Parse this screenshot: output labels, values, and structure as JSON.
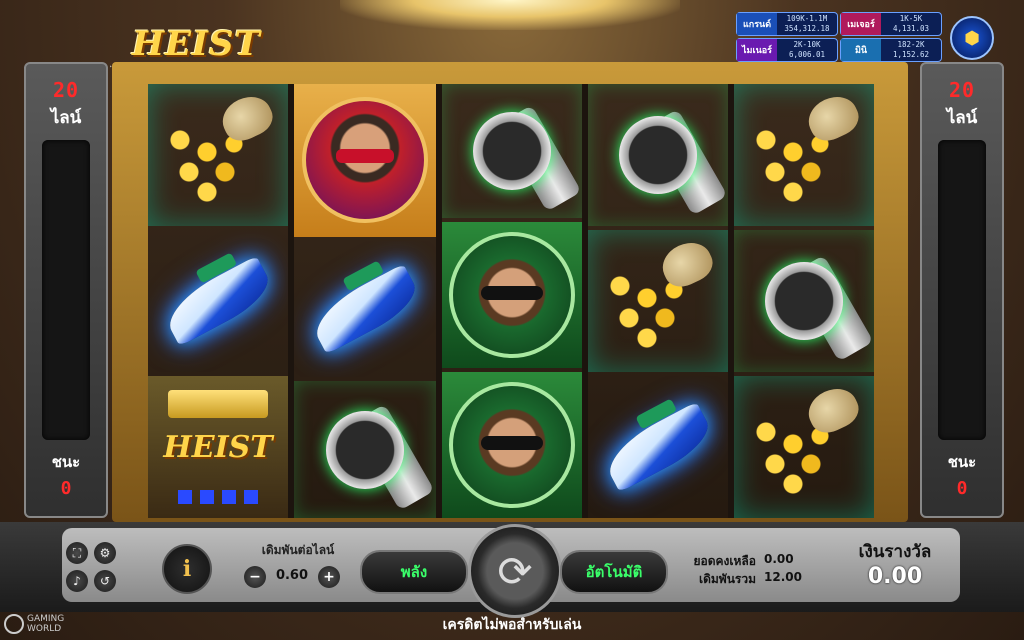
{
  "game": {
    "logo_text": "HEIST"
  },
  "jackpots": {
    "grand": {
      "name": "แกรนด์",
      "range": "109K-1.1M",
      "value": "354,312.18"
    },
    "major": {
      "name": "เมเจอร์",
      "range": "1K-5K",
      "value": "4,131.03"
    },
    "minor": {
      "name": "ไมเนอร์",
      "range": "2K-10K",
      "value": "6,006.01"
    },
    "mini": {
      "name": "มินิ",
      "range": "182-2K",
      "value": "1,152.62"
    }
  },
  "side_left": {
    "lines_value": "20",
    "lines_label": "ไลน์",
    "win_label": "ชนะ",
    "win_value": "0"
  },
  "side_right": {
    "lines_value": "20",
    "lines_label": "ไลน์",
    "win_label": "ชนะ",
    "win_value": "0"
  },
  "reels": [
    [
      "money-bag",
      "speedboat",
      "heist-wild"
    ],
    [
      "boss",
      "speedboat",
      "watch"
    ],
    [
      "watch",
      "masked-thief",
      "masked-thief"
    ],
    [
      "watch",
      "money-bag",
      "speedboat"
    ],
    [
      "money-bag",
      "watch",
      "money-bag"
    ]
  ],
  "heist_symbol_text": "HEIST",
  "controls": {
    "bet_per_line_label": "เดิมพันต่อไลน์",
    "bet_per_line_value": "0.60",
    "minus_label": "−",
    "plus_label": "+",
    "power_label": "พลัง",
    "auto_label": "อัตโนมัติ",
    "info_label": "i",
    "balance_label": "ยอดคงเหลือ",
    "balance_value": "0.00",
    "total_bet_label": "เดิมพันรวม",
    "total_bet_value": "12.00",
    "win_title": "เงินรางวัล",
    "win_amount": "0.00"
  },
  "footer_message": "เครดิตไม่พอสำหรับเล่น",
  "brand": {
    "line1": "GAMING",
    "line2": "WORLD"
  }
}
